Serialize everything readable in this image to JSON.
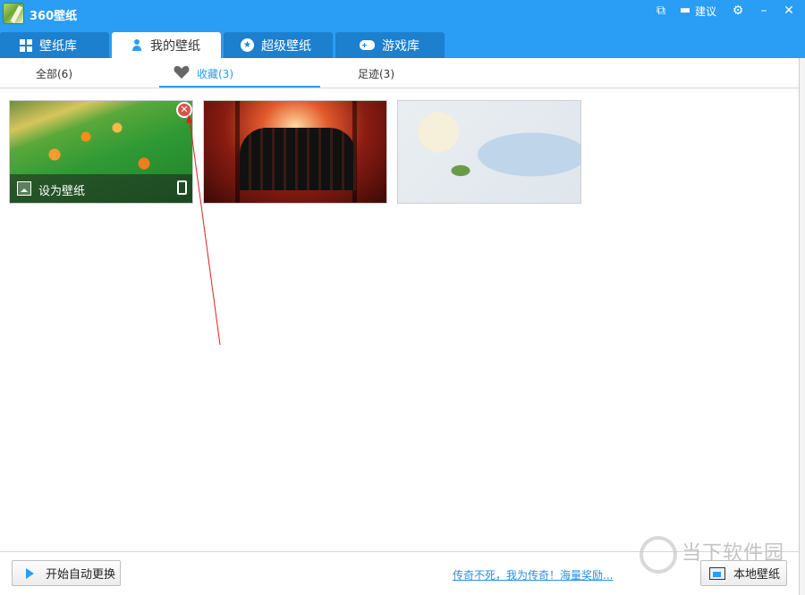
{
  "window": {
    "title": "360壁纸",
    "feedback_label": "建议"
  },
  "tabs": [
    {
      "label": "壁纸库",
      "icon": "grid-icon",
      "active": false
    },
    {
      "label": "我的壁纸",
      "icon": "user-icon",
      "active": true
    },
    {
      "label": "超级壁纸",
      "icon": "star-icon",
      "active": false
    },
    {
      "label": "游戏库",
      "icon": "gamepad-icon",
      "active": false
    }
  ],
  "subtabs": [
    {
      "label": "全部(6)",
      "active": false
    },
    {
      "label": "收藏(3)",
      "active": true
    },
    {
      "label": "足迹(3)",
      "active": false
    }
  ],
  "wallpapers": [
    {
      "name": "green-fields",
      "hovered": true,
      "set_label": "设为壁纸"
    },
    {
      "name": "anime-group-corridor",
      "hovered": false
    },
    {
      "name": "white-rose-shirt",
      "hovered": false
    }
  ],
  "footer": {
    "auto_change_label": "开始自动更换",
    "promo_text": "传奇不死，我为传奇！海量奖励...",
    "local_wallpaper_label": "本地壁纸"
  },
  "watermark": {
    "text": "当下软件园"
  },
  "colors": {
    "accent": "#2a9df4",
    "tab_inactive": "#1c80cf",
    "link": "#2a8ee6",
    "remove": "#d9534f",
    "annotation": "#e02020"
  }
}
